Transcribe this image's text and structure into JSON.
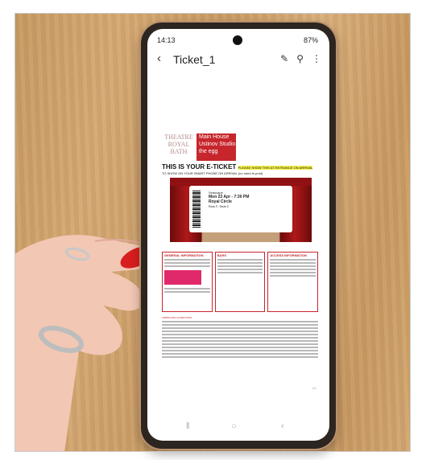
{
  "status": {
    "time": "14:13",
    "battery": "87%"
  },
  "app": {
    "title": "Ticket_1"
  },
  "document": {
    "theatre_logo": "THEATRE ROYAL BATH",
    "venue": "Main House Ustinov Studio the egg",
    "eticket_heading": "THIS IS YOUR E-TICKET",
    "eticket_note": "PLEASE SHOW THIS AT ENTRANCE ON ARRIVAL",
    "eticket_sub": "TO SHOW ON YOUR SMART PHONE ON ARRIVAL (no need to print)",
    "ticket_show": "Seascape",
    "ticket_date": "Mon 22 Apr - 7:30 PM",
    "ticket_section": "Royal Circle",
    "ticket_seat": "Row F, Seat 2",
    "box1_title": "GENERAL INFORMATION",
    "box2_title": "BARS",
    "box3_title": "ACCESS INFORMATION",
    "terms_title": "TERMS AND CONDITIONS",
    "page": "1/1"
  }
}
